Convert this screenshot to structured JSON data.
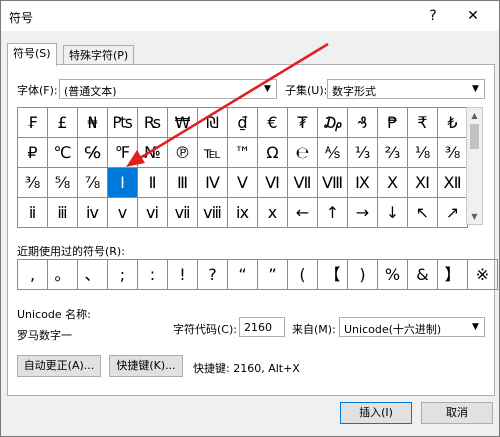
{
  "dialog": {
    "title": "符号",
    "help_glyph": "?",
    "close_glyph": "✕"
  },
  "tabs": [
    {
      "label": "符号(S)"
    },
    {
      "label": "特殊字符(P)"
    }
  ],
  "font": {
    "label": "字体(F):",
    "value": "(普通文本)"
  },
  "subset": {
    "label": "子集(U):",
    "value": "数字形式"
  },
  "grid": {
    "rows": [
      [
        "₣",
        "£",
        "₦",
        "₧",
        "₨",
        "₩",
        "₪",
        "₫",
        "€",
        "₮",
        "₯",
        "₰",
        "₱",
        "₹",
        "₺"
      ],
      [
        "₽",
        "℃",
        "℅",
        "℉",
        "№",
        "℗",
        "℡",
        "™",
        "Ω",
        "℮",
        "⅍",
        "⅓",
        "⅔",
        "⅛",
        "⅜"
      ],
      [
        "⅜",
        "⅝",
        "⅞",
        "Ⅰ",
        "Ⅱ",
        "Ⅲ",
        "Ⅳ",
        "Ⅴ",
        "Ⅵ",
        "Ⅶ",
        "Ⅷ",
        "Ⅸ",
        "Ⅹ",
        "Ⅺ",
        "Ⅻ"
      ],
      [
        "ⅱ",
        "ⅲ",
        "ⅳ",
        "ⅴ",
        "ⅵ",
        "ⅶ",
        "ⅷ",
        "ⅸ",
        "ⅹ",
        "←",
        "↑",
        "→",
        "↓",
        "↖",
        "↗"
      ]
    ],
    "selected": {
      "row": 2,
      "col": 3
    }
  },
  "recent": {
    "label": "近期使用过的符号(R):",
    "symbols": [
      ",",
      "。",
      "、",
      ";",
      ":",
      "!",
      "?",
      "“",
      "”",
      "(",
      "【",
      ")",
      "%",
      "&",
      "】",
      "※"
    ]
  },
  "unicode_name_label": "Unicode 名称:",
  "unicode_name_value": "罗马数字一",
  "char_code": {
    "label": "字符代码(C):",
    "value": "2160"
  },
  "from": {
    "label": "来自(M):",
    "value": "Unicode(十六进制)"
  },
  "buttons": {
    "autocorrect": "自动更正(A)...",
    "shortcut": "快捷键(K)...",
    "shortcut_info": "快捷键: 2160, Alt+X",
    "insert": "插入(I)",
    "cancel": "取消"
  }
}
